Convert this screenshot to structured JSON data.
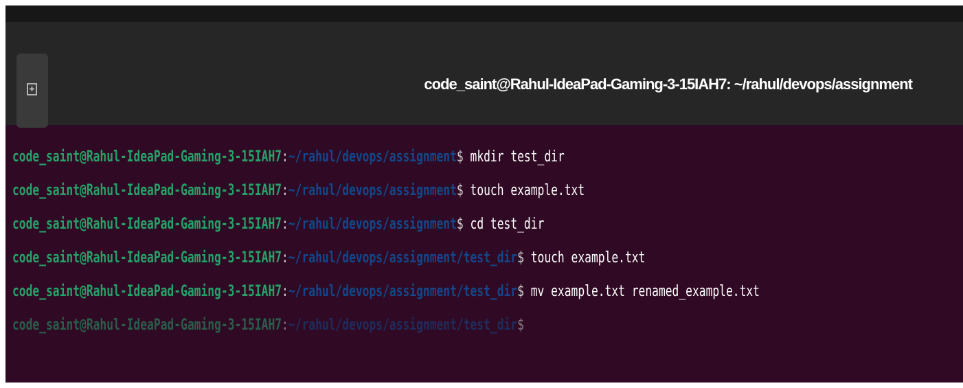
{
  "window": {
    "title": "code_saint@Rahul-IdeaPad-Gaming-3-15IAH7: ~/rahul/devops/assignment",
    "new_tab_icon": "new-tab-icon"
  },
  "colors": {
    "background": "#300a24",
    "user_host": "#26a269",
    "path": "#12488b",
    "text": "#ffffff"
  },
  "terminal": {
    "lines": [
      {
        "user_host": "code_saint@Rahul-IdeaPad-Gaming-3-15IAH7",
        "colon": ":",
        "path": "~/rahul/devops/assignment",
        "prompt": "$ ",
        "command": "mkdir test_dir"
      },
      {
        "user_host": "code_saint@Rahul-IdeaPad-Gaming-3-15IAH7",
        "colon": ":",
        "path": "~/rahul/devops/assignment",
        "prompt": "$ ",
        "command": "touch example.txt"
      },
      {
        "user_host": "code_saint@Rahul-IdeaPad-Gaming-3-15IAH7",
        "colon": ":",
        "path": "~/rahul/devops/assignment",
        "prompt": "$ ",
        "command": "cd test_dir"
      },
      {
        "user_host": "code_saint@Rahul-IdeaPad-Gaming-3-15IAH7",
        "colon": ":",
        "path": "~/rahul/devops/assignment/test_dir",
        "prompt": "$ ",
        "command": "touch example.txt"
      },
      {
        "user_host": "code_saint@Rahul-IdeaPad-Gaming-3-15IAH7",
        "colon": ":",
        "path": "~/rahul/devops/assignment/test_dir",
        "prompt": "$ ",
        "command": "mv example.txt renamed_example.txt"
      },
      {
        "user_host": "code_saint@Rahul-IdeaPad-Gaming-3-15IAH7",
        "colon": ":",
        "path": "~/rahul/devops/assignment/test_dir",
        "prompt": "$ ",
        "command": ""
      }
    ]
  }
}
